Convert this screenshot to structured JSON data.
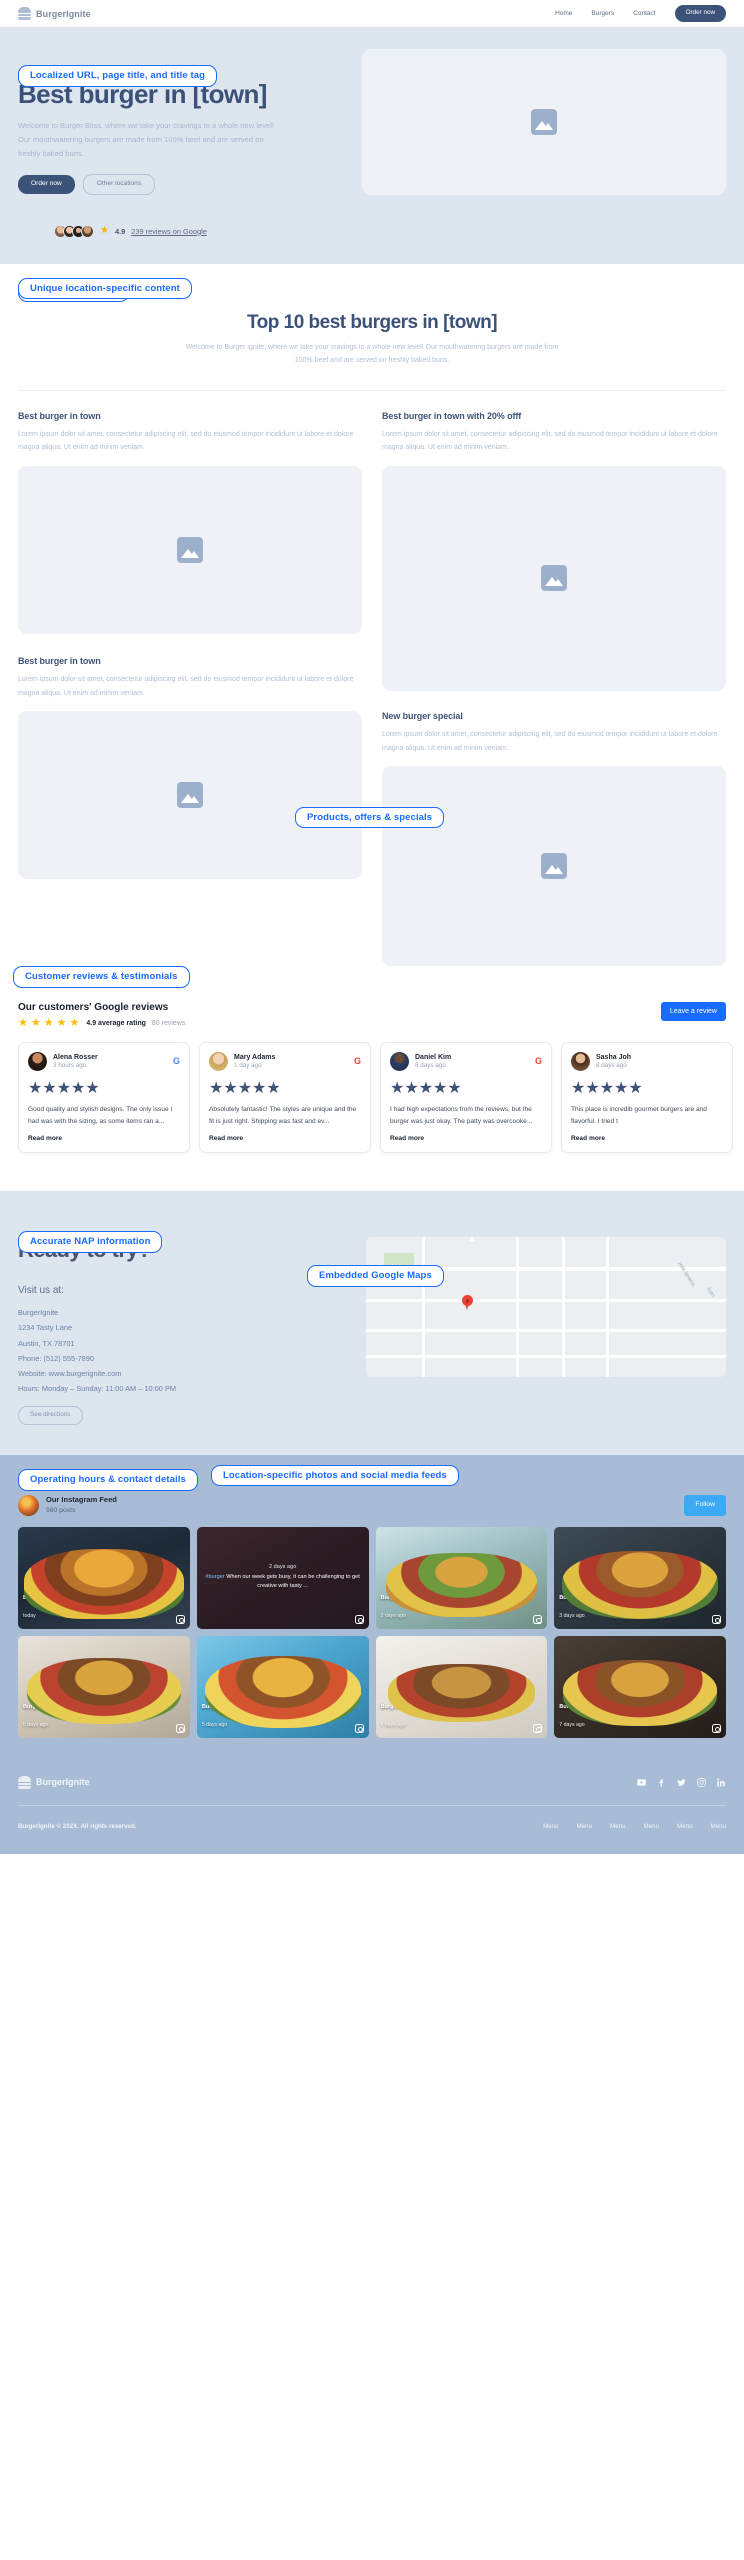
{
  "nav": {
    "brand": "BurgerIgnite",
    "links": [
      "Home",
      "Burgers",
      "Contact"
    ],
    "cta": "Order now"
  },
  "annotations": {
    "localized_url": "Localized URL, page title, and title tag",
    "social_proof": "Social proof badge",
    "unique_content": "Unique location-specific content",
    "products_offers": "Products, offers & specials",
    "customer_reviews": "Customer reviews & testimonials",
    "accurate_nap": "Accurate NAP information",
    "embedded_maps": "Embedded Google Maps",
    "operating_hours": "Operating hours & contact details",
    "location_photos": "Location-specific photos and social media feeds"
  },
  "hero": {
    "eyebrow": "BurgerIgnite",
    "title": "Best burger in [town]",
    "paragraph": "Welcome to Burger Bliss, where we take your cravings to a whole new level! Our mouthwatering burgers are made from 100% beef and are served on freshly baked buns.",
    "primary_cta": "Order now",
    "secondary_cta": "Other locations",
    "rating": "4.9",
    "reviews_link": "239 reviews on Google"
  },
  "section2": {
    "title": "Top 10 best burgers in [town]",
    "paragraph": "Welcome to Burger ignite, where we take your cravings to a whole new level! Our mouthwatering burgers are made from 100% beef and are served on freshly baked buns.",
    "body": "Lorem ipsum dolor sit amet, consectetur adipiscing elit, sed do eiusmod tempor incididunt ut labore et dolore magna aliqua. Ut enim ad minim veniam.",
    "cards": [
      {
        "title": "Best burger in town"
      },
      {
        "title": "Best burger in town with 20% offf"
      },
      {
        "title": "Best burger in town"
      },
      {
        "title": "New burger special"
      }
    ]
  },
  "reviews": {
    "heading": "Our customers' Google reviews",
    "average": "4.9 average rating",
    "count": "80 reviews",
    "leave_button": "Leave a review",
    "read_more": "Read more",
    "items": [
      {
        "name": "Alena Rosser",
        "time": "3 hours ago",
        "stars": "★★★★★",
        "text": "Good quality and stylish designs. The only issue I had was with the sizing, as some items ran a..."
      },
      {
        "name": "Mary Adams",
        "time": "1 day ago",
        "stars": "★★★★★",
        "text": "Absolutely fantastic! The styles are unique and the fit is just right. Shipping was fast and ev..."
      },
      {
        "name": "Daniel Kim",
        "time": "8 days ago",
        "stars": "★★★★★",
        "text": "I had high expectations from the reviews, but the burger was just okay. The patty was overcooke..."
      },
      {
        "name": "Sasha Joh",
        "time": "8 days ago",
        "stars": "★★★★★",
        "text": "This place is incredib gourmet burgers are and flavorful. I tried t"
      }
    ]
  },
  "ready": {
    "title": "Ready to try?",
    "visit_label": "Visit us at:",
    "business": "BurgerIgnite",
    "street": "1234 Tasty Lane",
    "city": "Austin, TX 78701",
    "phone": "Phone: (512) 555-7890",
    "website": "Website: www.burgerignite.com",
    "hours": "Hours: Monday – Sunday: 11:00 AM – 10:00 PM",
    "directions_button": "See directions",
    "map_labels": [
      "José Ignacio",
      "Juan"
    ]
  },
  "instagram": {
    "name": "Our Instagram Feed",
    "posts": "980 posts",
    "follow": "Follow",
    "tiles": [
      {
        "handle": "Burgerignite",
        "time": "today"
      },
      {
        "handle": "",
        "time": "2 days ago",
        "overlay_time": "2 days ago",
        "overlay_tag": "#burger",
        "overlay_text": " When our week gets busy, it can be challenging to get creative with tasty ..."
      },
      {
        "handle": "Burgerignite",
        "time": "2 days ago"
      },
      {
        "handle": "Burgerignite",
        "time": "3 days ago"
      },
      {
        "handle": "Burgerignite",
        "time": "5 days ago"
      },
      {
        "handle": "Burgerignite",
        "time": "5 days ago"
      },
      {
        "handle": "Burgerignite",
        "time": "6 days ago"
      },
      {
        "handle": "Burgerignite",
        "time": "7 days ago"
      }
    ]
  },
  "footer": {
    "brand": "BurgerIgnite",
    "socials": [
      "youtube-icon",
      "facebook-icon",
      "twitter-icon",
      "instagram-icon",
      "linkedin-icon"
    ],
    "copyright": "BurgerIgnite © 202X. All rights reserved.",
    "menu": [
      "Menu",
      "Menu",
      "Menu",
      "Menu",
      "Menu",
      "Menu"
    ]
  },
  "colors": {
    "accent": "#1a6bff",
    "hero_bg": "#dde5ef",
    "footer_bg": "#a9bcd5",
    "heading": "#3b5177",
    "star": "#fbbc04"
  }
}
